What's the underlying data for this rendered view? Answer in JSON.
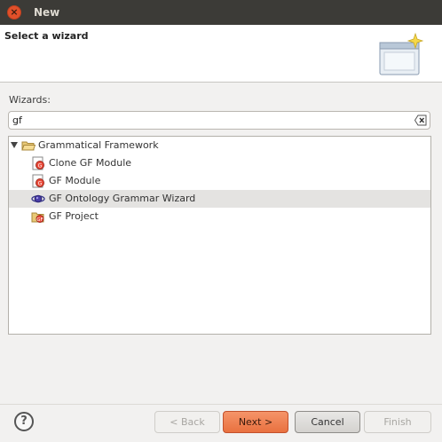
{
  "window": {
    "title": "New"
  },
  "header": {
    "title": "Select a wizard"
  },
  "filter": {
    "label": "Wizards:",
    "value": "gf"
  },
  "tree": {
    "category": "Grammatical Framework",
    "items": [
      {
        "label": "Clone GF Module",
        "icon": "gf-module-icon"
      },
      {
        "label": "GF Module",
        "icon": "gf-module-icon"
      },
      {
        "label": "GF Ontology Grammar Wizard",
        "icon": "ontology-icon",
        "selected": true
      },
      {
        "label": "GF Project",
        "icon": "gf-project-icon"
      }
    ]
  },
  "buttons": {
    "help": "?",
    "back": "< Back",
    "next": "Next >",
    "cancel": "Cancel",
    "finish": "Finish"
  },
  "colors": {
    "accent": "#e9713f",
    "titlebar": "#3c3b37",
    "close": "#e1502a"
  }
}
